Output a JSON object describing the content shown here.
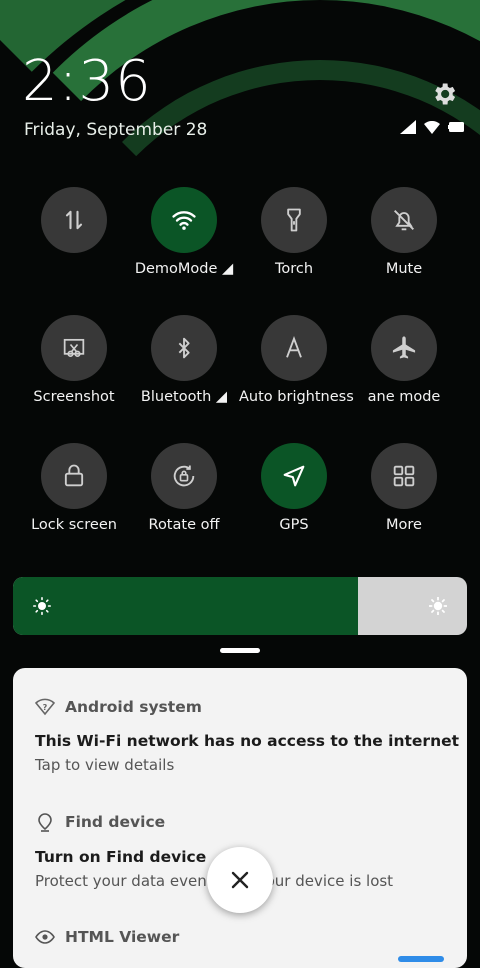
{
  "header": {
    "time": "2:36",
    "date": "Friday, September 28"
  },
  "tiles": [
    {
      "id": "data",
      "label": "",
      "icon": "data-transfer-icon",
      "on": false
    },
    {
      "id": "wifi",
      "label": "DemoMode ◢",
      "icon": "wifi-icon",
      "on": true
    },
    {
      "id": "torch",
      "label": "Torch",
      "icon": "flashlight-icon",
      "on": false
    },
    {
      "id": "mute",
      "label": "Mute",
      "icon": "bell-off-icon",
      "on": false
    },
    {
      "id": "screenshot",
      "label": "Screenshot",
      "icon": "screenshot-icon",
      "on": false
    },
    {
      "id": "bluetooth",
      "label": "Bluetooth ◢",
      "icon": "bluetooth-icon",
      "on": false
    },
    {
      "id": "autobrightness",
      "label": "Auto brightness",
      "icon": "auto-brightness-icon",
      "on": false
    },
    {
      "id": "airplane",
      "label": "ane mode",
      "icon": "airplane-icon",
      "on": false
    },
    {
      "id": "lockscreen",
      "label": "Lock screen",
      "icon": "lock-icon",
      "on": false
    },
    {
      "id": "rotate",
      "label": "Rotate off",
      "icon": "rotate-lock-icon",
      "on": false
    },
    {
      "id": "gps",
      "label": "GPS",
      "icon": "location-arrow-icon",
      "on": true
    },
    {
      "id": "more",
      "label": "More",
      "icon": "grid-icon",
      "on": false
    }
  ],
  "brightness": {
    "level_percent": 76
  },
  "notifications": [
    {
      "app": "Android system",
      "icon": "wifi-question-icon",
      "title": "This Wi-Fi network has no access to the internet",
      "body": "Tap to view details"
    },
    {
      "app": "Find device",
      "icon": "location-pin-icon",
      "title": "Turn on Find device",
      "body": "Protect your data even when your device is lost"
    },
    {
      "app": "HTML Viewer",
      "icon": "eye-icon",
      "title": "",
      "body": ""
    }
  ],
  "colors": {
    "accent_green": "#0b5526",
    "panel_bg": "#f3f3f3",
    "tile_off": "#464646"
  }
}
